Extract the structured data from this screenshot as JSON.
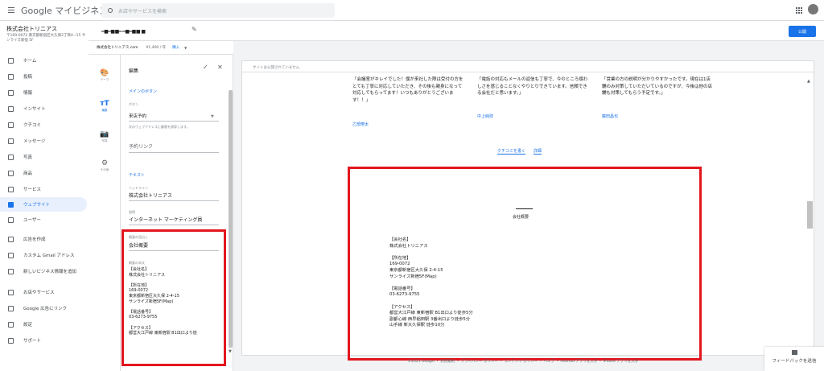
{
  "app": {
    "logo_google": "Google",
    "logo_product": "マイビジネス",
    "search_placeholder": "お店やサービスを検索"
  },
  "business": {
    "name": "株式会社トリニアス",
    "address": "〒169-0072 東京都新宿区大久保2丁目4−15 サンライズ新宿 5F"
  },
  "sidebar": {
    "items": [
      {
        "label": "ホーム",
        "icon": "home-icon"
      },
      {
        "label": "投稿",
        "icon": "posts-icon"
      },
      {
        "label": "情報",
        "icon": "info-icon"
      },
      {
        "label": "インサイト",
        "icon": "insights-icon"
      },
      {
        "label": "クチコミ",
        "icon": "reviews-icon"
      },
      {
        "label": "メッセージ",
        "icon": "messages-icon"
      },
      {
        "label": "写真",
        "icon": "photos-icon"
      },
      {
        "label": "商品",
        "icon": "products-icon"
      },
      {
        "label": "サービス",
        "icon": "services-icon"
      },
      {
        "label": "ウェブサイト",
        "icon": "website-icon",
        "active": true
      },
      {
        "label": "ユーザー",
        "icon": "users-icon"
      },
      {
        "label": "広告を作成",
        "icon": "ads-icon"
      },
      {
        "label": "カスタム Gmail アドレス",
        "icon": "gmail-icon"
      },
      {
        "label": "新しいビジネス情報を追加",
        "icon": "add-location-icon"
      },
      {
        "label": "お店やサービス",
        "icon": "store-icon"
      },
      {
        "label": "Google 広告にリンク",
        "icon": "link-icon"
      },
      {
        "label": "設定",
        "icon": "settings-icon"
      },
      {
        "label": "サポート",
        "icon": "help-icon"
      }
    ]
  },
  "pagebar": {
    "site_title": "━■━■■━ ━■━■■ ■",
    "publish": "公開"
  },
  "domain": {
    "name": "株式会社トリニアス.com",
    "price": "¥1,400 / 年",
    "buy": "購入"
  },
  "tools": [
    {
      "label": "テーマ",
      "icon": "theme-icon"
    },
    {
      "label": "編集",
      "icon": "edit-text-icon",
      "active": true
    },
    {
      "label": "写真",
      "icon": "camera-icon"
    },
    {
      "label": "その他",
      "icon": "settings-icon"
    }
  ],
  "editor": {
    "title": "編集",
    "main_button_section": "メインのボタン",
    "button_label": "ボタン",
    "button_value": "来店予約",
    "button_help": "次のウェブアドレスに顧客を誘導します。",
    "link_placeholder": "予約リンク",
    "text_section": "テキスト",
    "headline_label": "ヘッドライン",
    "headline_value": "株式会社トリニアス",
    "desc_label": "説明",
    "desc_value": "インターネット マーケティング員",
    "summary_heading_label": "概要の見出し",
    "summary_heading_value": "会社概要",
    "summary_body_label": "概要の本文",
    "summary_body": "【会社名】\n株式会社トリニアス\n\n【所在地】\n169-0072\n東京都新宿区大久保 2-4-15\nサンライズ新宿5F(Map)\n\n【電話番号】\n03-6273-9755\n\n【アクセス】\n都営大江戸線 東新宿駅 B1出口より徒"
  },
  "preview": {
    "notice": "サイトは公開されていません",
    "reviews": [
      {
        "text": "「会議室がキレイでした！僕が来社した際は受付の方をとても丁寧に対応していただき、その後も親身になって対応してもらってます！いつもありがとうございます！！」",
        "author": "乙部僚太"
      },
      {
        "text": "「電話の対応もメールの返信も丁寧で、今のところ煩わしさを感じることなくやりとりできています。信頼できる会社だと思います。」",
        "author": "中上純弥"
      },
      {
        "text": "「営業の方の説明が分かりやすかったです。現在は1店舗のみ対策していただいているのですが、今後は他の店舗も対策してもらう予定です。」",
        "author": "藤田昌也"
      }
    ],
    "write_review": "クチコミを書く",
    "details": "詳細",
    "about_heading": "会社概要",
    "about_body": "【会社名】\n株式会社トリニアス\n\n【所在地】\n169-0072\n東京都新宿区大久保 2-4-15\nサンライズ新宿5F(Map)\n\n【電話番号】\n03-6273-9755\n\n【アクセス】\n都営大江戸線 東新宿駅 B1出口より徒歩5分\n副都心線 西早稲田駅 3番出口より徒歩5分\n山手線 新大久保駅 徒歩10分"
  },
  "footer": {
    "text": "©2021 Google ・ 利用規約 ・ プライバシー ポリシー ・ コンテンツ ポリシー ・ ヘルプ ・ Android アプリを入手 ・ iPhone アプリを入手"
  },
  "feedback": {
    "label": "フィードバックを送信"
  },
  "colors": {
    "accent": "#1a73e8",
    "highlight_box": "#e3161e"
  }
}
